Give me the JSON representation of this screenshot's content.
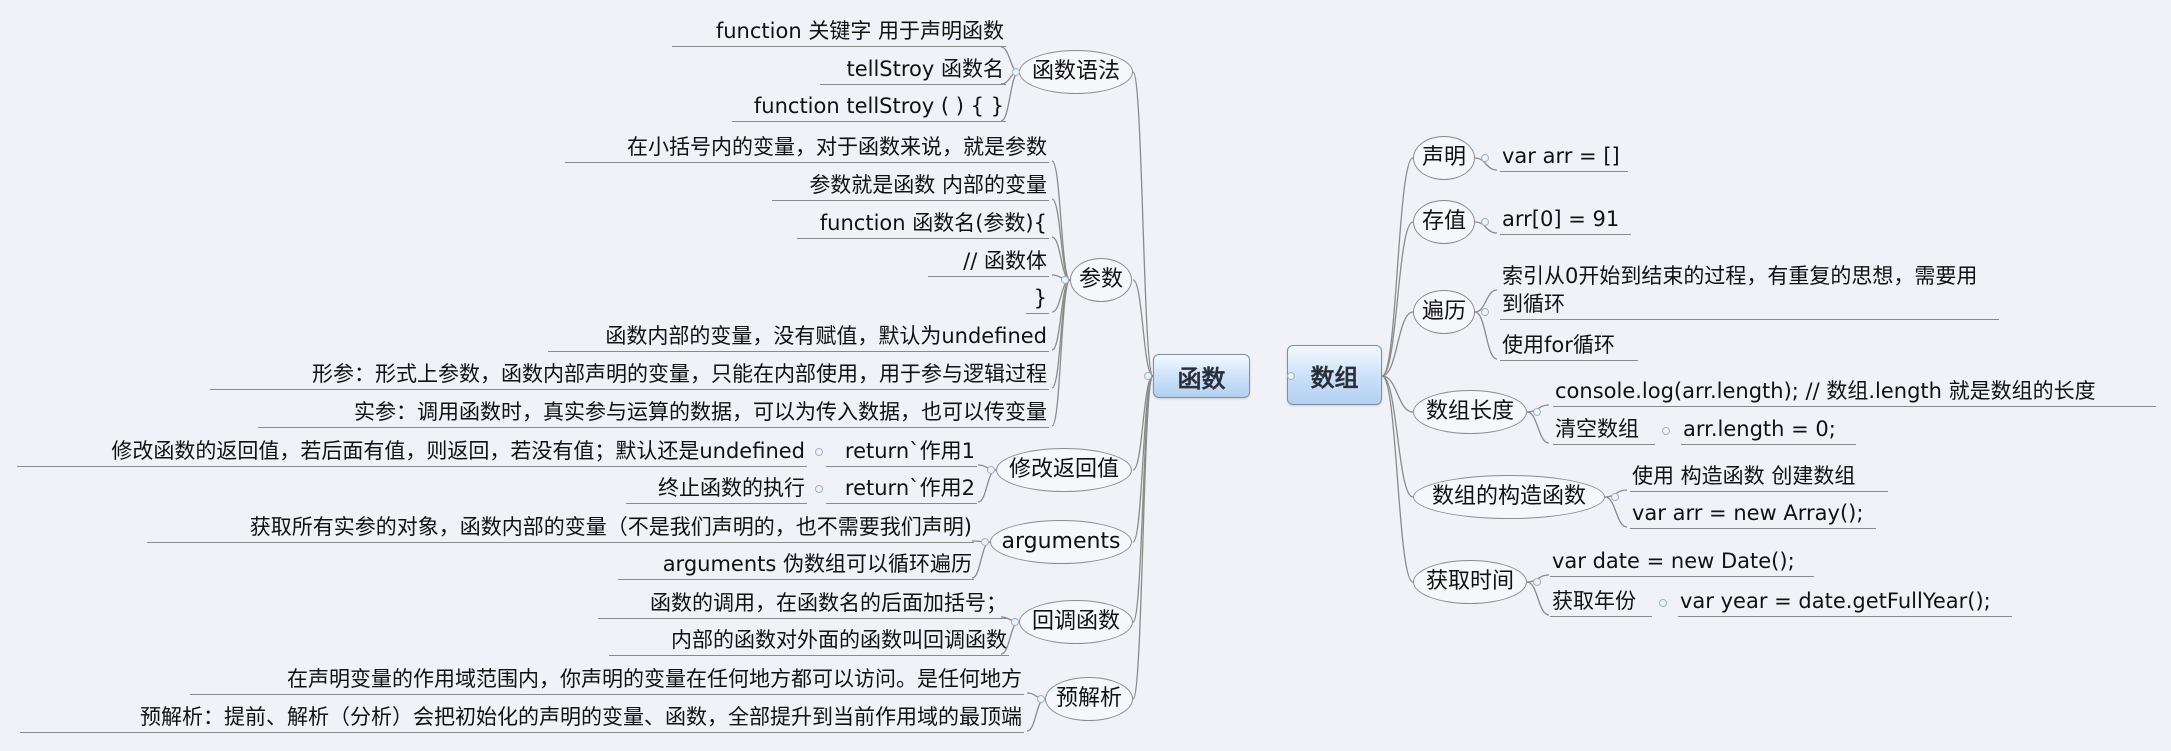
{
  "left": {
    "title": "函数",
    "branches": [
      {
        "label": "函数语法",
        "leaves": [
          "function 关键字 用于声明函数",
          "tellStroy 函数名",
          "function tellStroy ( )  { }"
        ]
      },
      {
        "label": "参数",
        "leaves": [
          "在小括号内的变量，对于函数来说，就是参数",
          "参数就是函数 内部的变量",
          "function 函数名(参数){",
          "// 函数体",
          "}",
          "函数内部的变量，没有赋值，默认为undefined",
          "形参：形式上参数，函数内部声明的变量，只能在内部使用，用于参与逻辑过程",
          "实参：调用函数时，真实参与运算的数据，可以为传入数据，也可以传变量"
        ]
      },
      {
        "label": "修改返回值",
        "leaves": [
          {
            "label": "return`作用1",
            "child": "修改函数的返回值，若后面有值，则返回，若没有值；默认还是undefined"
          },
          {
            "label": "return`作用2",
            "child": "终止函数的执行"
          }
        ]
      },
      {
        "label": "arguments",
        "leaves": [
          "获取所有实参的对象，函数内部的变量（不是我们声明的，也不需要我们声明)",
          "arguments 伪数组可以循环遍历"
        ]
      },
      {
        "label": "回调函数",
        "leaves": [
          "函数的调用，在函数名的后面加括号；",
          "内部的函数对外面的函数叫回调函数"
        ]
      },
      {
        "label": "预解析",
        "leaves": [
          "在声明变量的作用域范围内，你声明的变量在任何地方都可以访问。是任何地方",
          "预解析：提前、解析（分析）会把初始化的声明的变量、函数，全部提升到当前作用域的最顶端"
        ]
      }
    ]
  },
  "right": {
    "title": "数组",
    "branches": [
      {
        "label": "声明",
        "leaves": [
          "var arr = []"
        ]
      },
      {
        "label": "存值",
        "leaves": [
          "arr[0] = 91"
        ]
      },
      {
        "label": "遍历",
        "leaves": [
          "索引从0开始到结束的过程，有重复的思想，需要用到循环",
          "使用for循环"
        ]
      },
      {
        "label": "数组长度",
        "leaves": [
          "console.log(arr.length); // 数组.length 就是数组的长度",
          {
            "label": "清空数组",
            "child": "arr.length = 0;"
          }
        ]
      },
      {
        "label": "数组的构造函数",
        "leaves": [
          "使用 构造函数 创建数组",
          "var arr = new Array();"
        ]
      },
      {
        "label": "获取时间",
        "leaves": [
          "var date = new Date();",
          {
            "label": "获取年份",
            "child": "var year = date.getFullYear();"
          }
        ]
      }
    ]
  },
  "colors": {
    "line": "#8a8a8a",
    "mainTop": "#f4f9ff",
    "mainBottom": "#b3d0f0",
    "background": "#f1f2f7"
  }
}
